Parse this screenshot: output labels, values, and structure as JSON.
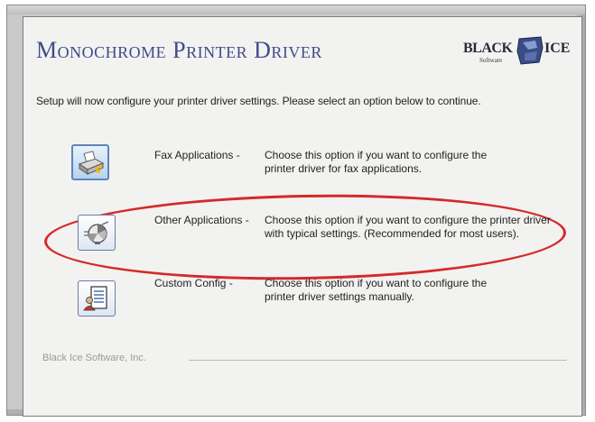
{
  "dialog": {
    "title": "Monochrome Printer Driver",
    "logo": {
      "part1": "BLACK",
      "part2": "ICE",
      "sub": "Software"
    },
    "instruction": "Setup will now configure your printer driver settings. Please select an option below to continue.",
    "options": [
      {
        "label": "Fax Applications -",
        "description": "Choose this option if you want to configure the printer driver for fax applications.",
        "icon": "fax-icon"
      },
      {
        "label": "Other Applications -",
        "description": "Choose this option if you want to configure the printer driver with typical settings. (Recommended for most users).",
        "icon": "pie-chart-icon",
        "highlighted": true
      },
      {
        "label": "Custom Config -",
        "description": "Choose this option if you want to configure the printer driver settings manually.",
        "icon": "custom-config-icon"
      }
    ],
    "footer": "Black Ice Software, Inc.",
    "colors": {
      "title": "#414b8c",
      "highlight_oval": "#d42a2a",
      "panel_bg": "#f2f2f0"
    }
  }
}
